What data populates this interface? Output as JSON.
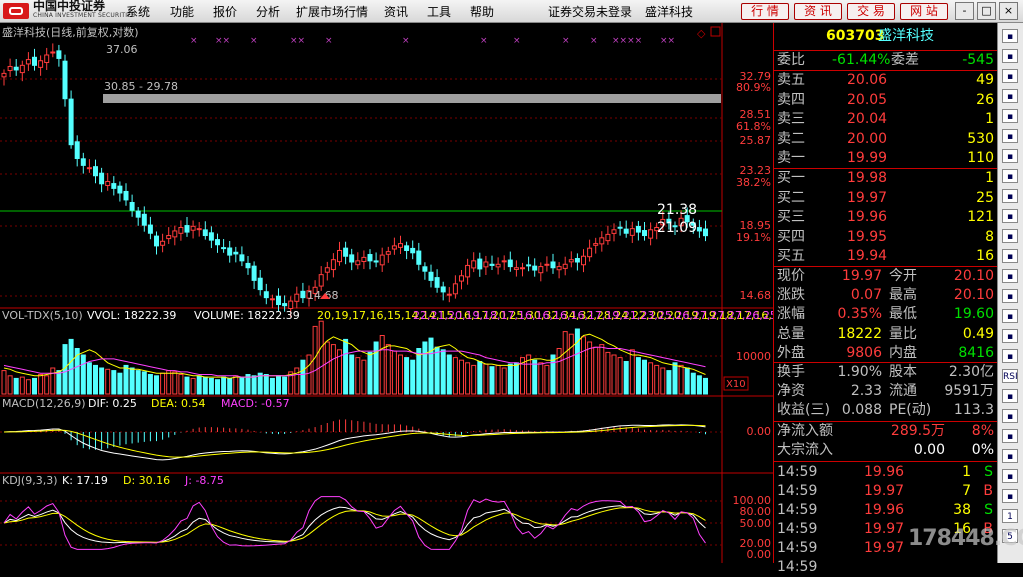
{
  "app": {
    "logo_cn": "中国中投证券",
    "logo_en": "CHINA INVESTMENT SECURITIES",
    "menu": [
      "系统",
      "功能",
      "报价",
      "分析",
      "扩展市场行情",
      "资讯",
      "工具",
      "帮助"
    ],
    "status": "证券交易未登录",
    "stock_title": "盛洋科技",
    "tab_buttons": [
      "行 情",
      "资 讯",
      "交 易",
      "网 站"
    ],
    "window_buttons": [
      "-",
      "□",
      "×"
    ]
  },
  "main_chart": {
    "title": "盛洋科技(日线,前复权,对数)",
    "price_labels": [
      "32.79",
      "28.51",
      "25.87",
      "23.23",
      "18.95",
      "14.68"
    ],
    "pct_labels": [
      "80.9%",
      "61.8%",
      "38.2%",
      "19.1%"
    ],
    "annotations": {
      "high": "37.06",
      "low": "14.68",
      "gap": "30.85 - 29.78",
      "current1": "21.38",
      "current2": "21.09"
    },
    "candles": [
      35.2,
      35.8,
      35.5,
      35.9,
      36.4,
      35.9,
      36.3,
      36.8,
      37.06,
      36.5,
      33.0,
      29.0,
      27.8,
      27.2,
      27.0,
      26.3,
      25.6,
      25.8,
      25.2,
      24.8,
      24.2,
      23.3,
      22.7,
      22.0,
      21.3,
      20.2,
      20.6,
      21.1,
      21.5,
      21.8,
      21.4,
      21.9,
      21.7,
      21.1,
      20.7,
      20.3,
      20.0,
      19.4,
      19.5,
      18.9,
      18.3,
      17.2,
      16.4,
      15.7,
      15.6,
      15.1,
      15.0,
      15.4,
      16.0,
      15.7,
      16.3,
      16.6,
      17.7,
      18.3,
      19.0,
      19.8,
      19.3,
      18.8,
      18.9,
      19.2,
      18.9,
      18.8,
      19.4,
      19.7,
      20.2,
      20.4,
      19.8,
      19.6,
      18.6,
      18.0,
      17.2,
      16.6,
      16.2,
      16.0,
      16.9,
      17.6,
      18.5,
      18.9,
      18.2,
      18.8,
      18.5,
      18.6,
      18.9,
      18.4,
      18.3,
      18.3,
      18.5,
      18.1,
      18.4,
      18.6,
      18.3,
      18.4,
      18.6,
      19.0,
      18.8,
      19.3,
      20.0,
      20.4,
      20.9,
      21.2,
      21.6,
      21.8,
      21.3,
      21.7,
      21.4,
      21.1,
      21.6,
      21.8,
      22.5,
      22.2,
      21.9,
      22.6,
      22.3,
      22.0,
      21.5,
      21.09
    ]
  },
  "volume_chart": {
    "label": "VOL-TDX(5,10)",
    "vvol": "VVOL: 18222.39",
    "volume": "VOLUME: 18222.39",
    "ma5": [
      20,
      19,
      17,
      16,
      15,
      14,
      14,
      15,
      16,
      17,
      20,
      25,
      30,
      32,
      34,
      32,
      28,
      24,
      22,
      20,
      20,
      19,
      19,
      18,
      17,
      16,
      16,
      16,
      16,
      16,
      15,
      14,
      14,
      13,
      13,
      13,
      13,
      12,
      13,
      13,
      13,
      13,
      14,
      14,
      14,
      14,
      14,
      15,
      16,
      18,
      22,
      28,
      36,
      41,
      44,
      42,
      40,
      38,
      34,
      32,
      30,
      32,
      35,
      37,
      37,
      36,
      35,
      32,
      30,
      31,
      33,
      36,
      37,
      38,
      35,
      31,
      28,
      27,
      25,
      23,
      23,
      22,
      22,
      22,
      22,
      24,
      26,
      27,
      27,
      26,
      26,
      28,
      32,
      36,
      40,
      45,
      46,
      44,
      42,
      39,
      37,
      34,
      32,
      30,
      30,
      29,
      28,
      26,
      24,
      23,
      22,
      21,
      20,
      19,
      17,
      15
    ],
    "ma10": [
      22,
      21,
      20,
      19,
      18,
      17,
      16,
      16,
      16,
      16,
      17,
      19,
      21,
      23,
      25,
      26,
      27,
      27,
      27,
      26,
      25,
      24,
      23,
      22,
      21,
      20,
      19,
      18,
      18,
      17,
      17,
      16,
      15,
      15,
      15,
      14,
      14,
      14,
      14,
      13,
      13,
      13,
      14,
      14,
      14,
      14,
      14,
      14,
      15,
      15,
      16,
      18,
      21,
      24,
      27,
      29,
      31,
      32,
      33,
      33,
      33,
      33,
      34,
      34,
      33,
      33,
      33,
      32,
      31,
      31,
      31,
      32,
      33,
      33,
      33,
      33,
      32,
      31,
      30,
      28,
      27,
      26,
      25,
      24,
      24,
      23,
      23,
      23,
      23,
      24,
      24,
      25,
      27,
      29,
      31,
      33,
      35,
      36,
      36,
      35,
      35,
      35,
      34,
      33,
      32,
      31,
      30,
      29,
      28,
      27,
      26,
      25,
      24,
      23,
      22,
      21
    ],
    "axis": "10000",
    "unit": "X10",
    "bars": [
      18,
      14,
      12,
      13,
      11,
      12,
      15,
      14,
      20,
      18,
      38,
      42,
      35,
      30,
      24,
      22,
      20,
      19,
      18,
      16,
      22,
      20,
      18,
      17,
      15,
      14,
      16,
      18,
      17,
      15,
      13,
      12,
      14,
      13,
      12,
      11,
      13,
      12,
      14,
      13,
      15,
      14,
      16,
      15,
      12,
      14,
      13,
      17,
      20,
      26,
      30,
      52,
      56,
      40,
      38,
      34,
      42,
      30,
      28,
      26,
      32,
      40,
      45,
      38,
      33,
      30,
      28,
      26,
      35,
      40,
      43,
      36,
      34,
      30,
      28,
      26,
      24,
      22,
      25,
      23,
      21,
      22,
      20,
      23,
      24,
      28,
      30,
      26,
      24,
      22,
      30,
      35,
      48,
      46,
      50,
      44,
      40,
      36,
      38,
      32,
      30,
      28,
      25,
      34,
      28,
      26,
      24,
      22,
      20,
      18,
      24,
      22,
      20,
      16,
      14,
      12
    ]
  },
  "macd_chart": {
    "label": "MACD(12,26,9)",
    "dif": "DIF: 0.25",
    "dea": "DEA: 0.54",
    "macd": "MACD: -0.57",
    "axis": "0.00"
  },
  "kdj_chart": {
    "label": "KDJ(9,3,3)",
    "k": "K: 17.19",
    "d": "D: 30.16",
    "j": "J: -8.75",
    "axis": [
      "100.00",
      "80.00",
      "50.00",
      "20.00",
      "0.00"
    ]
  },
  "quote": {
    "code": "603703",
    "name": "盛洋科技",
    "ratio_label": "委比",
    "ratio": "-61.44%",
    "diff_label": "委差",
    "diff": "-545",
    "asks": [
      {
        "label": "卖五",
        "price": "20.06",
        "vol": "49"
      },
      {
        "label": "卖四",
        "price": "20.05",
        "vol": "26"
      },
      {
        "label": "卖三",
        "price": "20.04",
        "vol": "1"
      },
      {
        "label": "卖二",
        "price": "20.00",
        "vol": "530"
      },
      {
        "label": "卖一",
        "price": "19.99",
        "vol": "110"
      }
    ],
    "bids": [
      {
        "label": "买一",
        "price": "19.98",
        "vol": "1"
      },
      {
        "label": "买二",
        "price": "19.97",
        "vol": "25"
      },
      {
        "label": "买三",
        "price": "19.96",
        "vol": "121"
      },
      {
        "label": "买四",
        "price": "19.95",
        "vol": "8"
      },
      {
        "label": "买五",
        "price": "19.94",
        "vol": "16"
      }
    ],
    "stats": [
      {
        "l1": "现价",
        "v1": "19.97",
        "l2": "今开",
        "v2": "20.10",
        "c1": "#ff3c3c",
        "c2": "#ff3c3c"
      },
      {
        "l1": "涨跌",
        "v1": "0.07",
        "l2": "最高",
        "v2": "20.10",
        "c1": "#ff3c3c",
        "c2": "#ff3c3c"
      },
      {
        "l1": "涨幅",
        "v1": "0.35%",
        "l2": "最低",
        "v2": "19.60",
        "c1": "#ff3c3c",
        "c2": "#00e000"
      },
      {
        "l1": "总量",
        "v1": "18222",
        "l2": "量比",
        "v2": "0.49",
        "c1": "#ffff00",
        "c2": "#ffff00"
      },
      {
        "l1": "外盘",
        "v1": "9806",
        "l2": "内盘",
        "v2": "8416",
        "c1": "#ff3c3c",
        "c2": "#00e000"
      }
    ],
    "stats2": [
      {
        "l1": "换手",
        "v1": "1.90%",
        "l2": "股本",
        "v2": "2.30亿"
      },
      {
        "l1": "净资",
        "v1": "2.33",
        "l2": "流通",
        "v2": "9591万"
      },
      {
        "l1": "收益(三)",
        "v1": "0.088",
        "l2": "PE(动)",
        "v2": "113.3"
      }
    ],
    "flow": [
      {
        "label": "净流入额",
        "v1": "289.5万",
        "v2": "8%"
      },
      {
        "label": "大宗流入",
        "v1": "0.00",
        "v2": "0%"
      }
    ],
    "ticks": [
      {
        "time": "14:59",
        "price": "19.96",
        "vol": "1",
        "side": "S"
      },
      {
        "time": "14:59",
        "price": "19.97",
        "vol": "7",
        "side": "B"
      },
      {
        "time": "14:59",
        "price": "19.96",
        "vol": "38",
        "side": "S"
      },
      {
        "time": "14:59",
        "price": "19.97",
        "vol": "16",
        "side": "B"
      },
      {
        "time": "14:59",
        "price": "19.97",
        "vol": "",
        "side": ""
      },
      {
        "time": "14:59",
        "price": "",
        "vol": "",
        "side": ""
      }
    ]
  },
  "toolbar": [
    "RSI",
    "1",
    "5"
  ],
  "watermark": "178448.COM",
  "colors": {
    "up": "#ff3c3c",
    "down": "#54ffff",
    "accent": "#c00000",
    "yellow": "#ffff00",
    "green": "#00e000"
  }
}
